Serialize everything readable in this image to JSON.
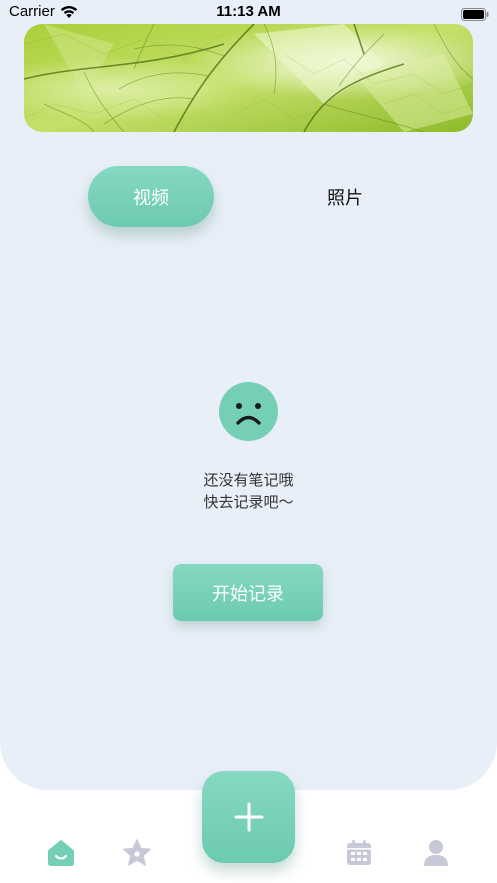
{
  "status_bar": {
    "carrier": "Carrier",
    "time": "11:13 AM"
  },
  "banner": {
    "image": "green-leaf-veins-photo"
  },
  "tabs": [
    {
      "label": "视频",
      "selected": true
    },
    {
      "label": "照片",
      "selected": false
    }
  ],
  "empty_state": {
    "icon": "sad-face-icon",
    "line1": "还没有笔记哦",
    "line2": "快去记录吧～",
    "button_label": "开始记录"
  },
  "bottom_nav": {
    "items": [
      {
        "icon": "home-icon",
        "active": true
      },
      {
        "icon": "star-icon",
        "active": false
      },
      {
        "icon": "plus-icon",
        "active": false
      },
      {
        "icon": "calendar-icon",
        "active": false
      },
      {
        "icon": "profile-icon",
        "active": false
      }
    ]
  },
  "colors": {
    "accent": "#74cfb6",
    "background": "#e9eff8",
    "inactive_icon": "#c7c9d9"
  }
}
